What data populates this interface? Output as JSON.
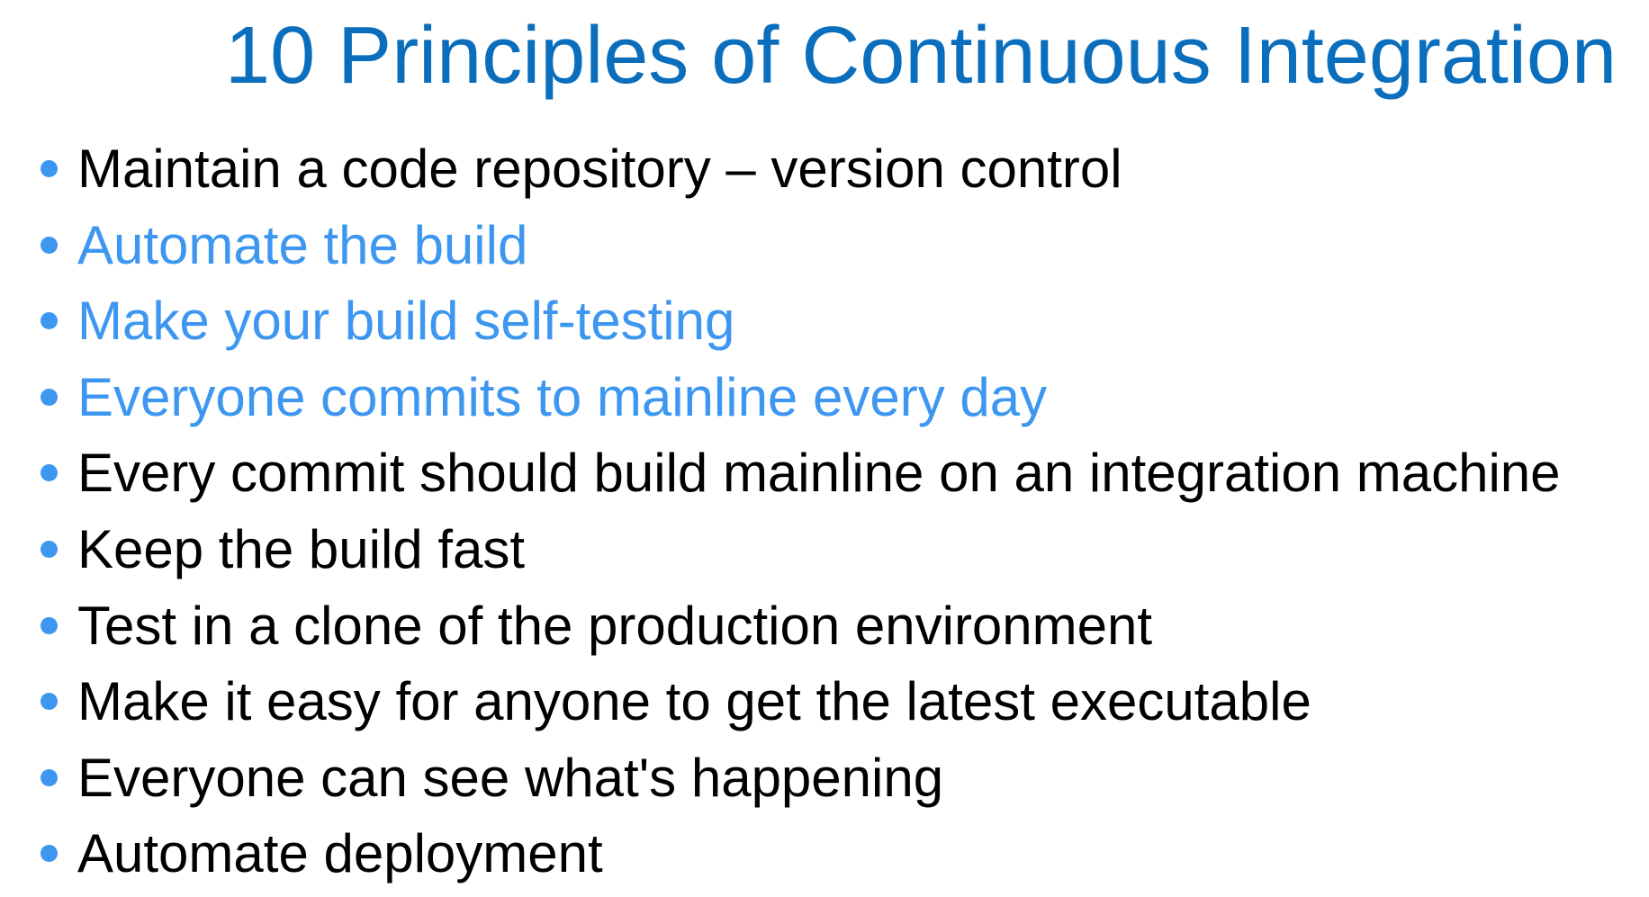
{
  "slide": {
    "title": "10 Principles of Continuous Integration",
    "colors": {
      "title": "#0a6ebd",
      "text_default": "#000000",
      "text_highlight": "#3d97f0",
      "bullet": "#3d97f0"
    },
    "items": [
      {
        "text": "Maintain a code repository – version control",
        "highlighted": false
      },
      {
        "text": "Automate the build",
        "highlighted": true
      },
      {
        "text": "Make your build self-testing",
        "highlighted": true
      },
      {
        "text": "Everyone commits to mainline every day",
        "highlighted": true
      },
      {
        "text": "Every commit should build mainline on an integration machine",
        "highlighted": false
      },
      {
        "text": "Keep the build fast",
        "highlighted": false
      },
      {
        "text": "Test in a clone of the production environment",
        "highlighted": false
      },
      {
        "text": "Make it easy for anyone to get the latest executable",
        "highlighted": false
      },
      {
        "text": "Everyone can see what's happening",
        "highlighted": false
      },
      {
        "text": "Automate deployment",
        "highlighted": false
      }
    ]
  }
}
